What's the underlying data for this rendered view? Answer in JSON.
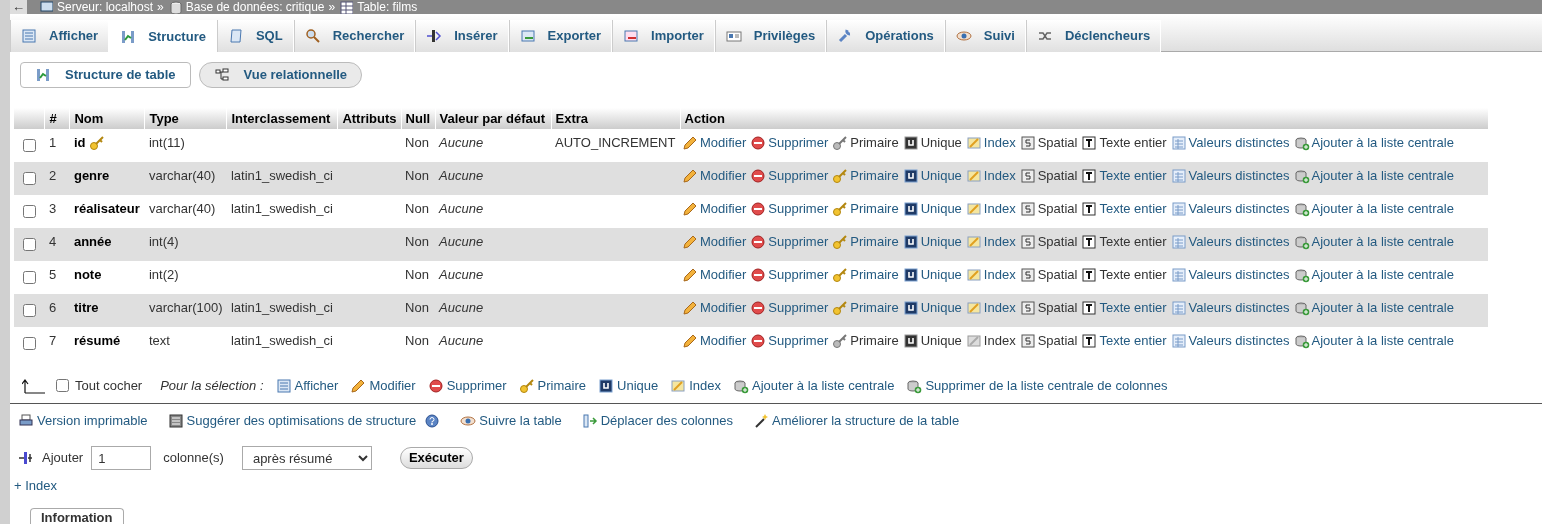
{
  "breadcrumb": {
    "back": "←",
    "items": [
      {
        "label": "Serveur: localhost",
        "separator": "»"
      },
      {
        "label": "Base de données: critique",
        "separator": "»"
      },
      {
        "label": "Table: films"
      }
    ]
  },
  "tabs": [
    {
      "label": "Afficher",
      "selected": false
    },
    {
      "label": "Structure",
      "selected": true
    },
    {
      "label": "SQL",
      "selected": false
    },
    {
      "label": "Rechercher",
      "selected": false
    },
    {
      "label": "Insérer",
      "selected": false
    },
    {
      "label": "Exporter",
      "selected": false
    },
    {
      "label": "Importer",
      "selected": false
    },
    {
      "label": "Privilèges",
      "selected": false
    },
    {
      "label": "Opérations",
      "selected": false
    },
    {
      "label": "Suivi",
      "selected": false
    },
    {
      "label": "Déclencheurs",
      "selected": false
    }
  ],
  "subtabs": [
    {
      "label": "Structure de table",
      "selected": true
    },
    {
      "label": "Vue relationnelle",
      "selected": false
    }
  ],
  "table": {
    "columns": [
      "#",
      "Nom",
      "Type",
      "Interclassement",
      "Attributs",
      "Null",
      "Valeur par défaut",
      "Extra",
      "Action"
    ],
    "rows": [
      {
        "checked": false,
        "num": "1",
        "name": "id",
        "primary_key": true,
        "type": "int(11)",
        "null": "Non",
        "default": "Aucune",
        "extra": "AUTO_INCREMENT",
        "actions": [
          {
            "label": "Modifier",
            "disabled": false
          },
          {
            "label": "Supprimer",
            "disabled": false
          },
          {
            "label": "Primaire",
            "disabled": true
          },
          {
            "label": "Unique",
            "disabled": true
          },
          {
            "label": "Index",
            "disabled": false
          },
          {
            "label": "Spatial",
            "disabled": true
          },
          {
            "label": "Texte entier",
            "disabled": true
          },
          {
            "label": "Valeurs distinctes",
            "disabled": false
          },
          {
            "label": "Ajouter à la liste centrale",
            "disabled": false
          }
        ]
      },
      {
        "checked": false,
        "num": "2",
        "name": "genre",
        "primary_key": false,
        "type": "varchar(40)",
        "collation": "latin1_swedish_ci",
        "null": "Non",
        "default": "Aucune",
        "actions": [
          {
            "label": "Modifier",
            "disabled": false
          },
          {
            "label": "Supprimer",
            "disabled": false
          },
          {
            "label": "Primaire",
            "disabled": false
          },
          {
            "label": "Unique",
            "disabled": false
          },
          {
            "label": "Index",
            "disabled": false
          },
          {
            "label": "Spatial",
            "disabled": true
          },
          {
            "label": "Texte entier",
            "disabled": false
          },
          {
            "label": "Valeurs distinctes",
            "disabled": false
          },
          {
            "label": "Ajouter à la liste centrale",
            "disabled": false
          }
        ]
      },
      {
        "checked": false,
        "num": "3",
        "name": "réalisateur",
        "primary_key": false,
        "type": "varchar(40)",
        "collation": "latin1_swedish_ci",
        "null": "Non",
        "default": "Aucune",
        "actions": [
          {
            "label": "Modifier",
            "disabled": false
          },
          {
            "label": "Supprimer",
            "disabled": false
          },
          {
            "label": "Primaire",
            "disabled": false
          },
          {
            "label": "Unique",
            "disabled": false
          },
          {
            "label": "Index",
            "disabled": false
          },
          {
            "label": "Spatial",
            "disabled": true
          },
          {
            "label": "Texte entier",
            "disabled": false
          },
          {
            "label": "Valeurs distinctes",
            "disabled": false
          },
          {
            "label": "Ajouter à la liste centrale",
            "disabled": false
          }
        ]
      },
      {
        "checked": false,
        "num": "4",
        "name": "année",
        "primary_key": false,
        "type": "int(4)",
        "null": "Non",
        "default": "Aucune",
        "actions": [
          {
            "label": "Modifier",
            "disabled": false
          },
          {
            "label": "Supprimer",
            "disabled": false
          },
          {
            "label": "Primaire",
            "disabled": false
          },
          {
            "label": "Unique",
            "disabled": false
          },
          {
            "label": "Index",
            "disabled": false
          },
          {
            "label": "Spatial",
            "disabled": true
          },
          {
            "label": "Texte entier",
            "disabled": true
          },
          {
            "label": "Valeurs distinctes",
            "disabled": false
          },
          {
            "label": "Ajouter à la liste centrale",
            "disabled": false
          }
        ]
      },
      {
        "checked": false,
        "num": "5",
        "name": "note",
        "primary_key": false,
        "type": "int(2)",
        "null": "Non",
        "default": "Aucune",
        "actions": [
          {
            "label": "Modifier",
            "disabled": false
          },
          {
            "label": "Supprimer",
            "disabled": false
          },
          {
            "label": "Primaire",
            "disabled": false
          },
          {
            "label": "Unique",
            "disabled": false
          },
          {
            "label": "Index",
            "disabled": false
          },
          {
            "label": "Spatial",
            "disabled": true
          },
          {
            "label": "Texte entier",
            "disabled": true
          },
          {
            "label": "Valeurs distinctes",
            "disabled": false
          },
          {
            "label": "Ajouter à la liste centrale",
            "disabled": false
          }
        ]
      },
      {
        "checked": false,
        "num": "6",
        "name": "titre",
        "primary_key": false,
        "type": "varchar(100)",
        "collation": "latin1_swedish_ci",
        "null": "Non",
        "default": "Aucune",
        "actions": [
          {
            "label": "Modifier",
            "disabled": false
          },
          {
            "label": "Supprimer",
            "disabled": false
          },
          {
            "label": "Primaire",
            "disabled": false
          },
          {
            "label": "Unique",
            "disabled": false
          },
          {
            "label": "Index",
            "disabled": false
          },
          {
            "label": "Spatial",
            "disabled": true
          },
          {
            "label": "Texte entier",
            "disabled": false
          },
          {
            "label": "Valeurs distinctes",
            "disabled": false
          },
          {
            "label": "Ajouter à la liste centrale",
            "disabled": false
          }
        ]
      },
      {
        "checked": false,
        "num": "7",
        "name": "résumé",
        "primary_key": false,
        "type": "text",
        "collation": "latin1_swedish_ci",
        "null": "Non",
        "default": "Aucune",
        "actions": [
          {
            "label": "Modifier",
            "disabled": false
          },
          {
            "label": "Supprimer",
            "disabled": false
          },
          {
            "label": "Primaire",
            "disabled": true
          },
          {
            "label": "Unique",
            "disabled": true
          },
          {
            "label": "Index",
            "disabled": true
          },
          {
            "label": "Spatial",
            "disabled": true
          },
          {
            "label": "Texte entier",
            "disabled": false
          },
          {
            "label": "Valeurs distinctes",
            "disabled": false
          },
          {
            "label": "Ajouter à la liste centrale",
            "disabled": false
          }
        ]
      }
    ]
  },
  "selection": {
    "check_all": {
      "label": "Tout cocher",
      "checked": false
    },
    "label": "Pour la sélection :",
    "actions": [
      {
        "label": "Afficher",
        "kind": "list"
      },
      {
        "label": "Modifier",
        "kind": "pencil"
      },
      {
        "label": "Supprimer",
        "kind": "delete"
      },
      {
        "label": "Primaire",
        "kind": "key"
      },
      {
        "label": "Unique",
        "kind": "unique"
      },
      {
        "label": "Index",
        "kind": "index"
      },
      {
        "label": "Ajouter à la liste centrale",
        "kind": "central"
      },
      {
        "label": "Supprimer de la liste centrale de colonnes",
        "kind": "central"
      }
    ]
  },
  "links": [
    {
      "label": "Version imprimable",
      "kind": "print"
    },
    {
      "label": "Suggérer des optimisations de structure",
      "kind": "suggest",
      "help": true
    },
    {
      "label": "Suivre la table",
      "kind": "eye"
    },
    {
      "label": "Déplacer des colonnes",
      "kind": "move"
    },
    {
      "label": "Améliorer la structure de la table",
      "kind": "wand"
    }
  ],
  "add_column": {
    "label": "Ajouter",
    "value": "1",
    "unit": "colonne(s)",
    "position": "après résumé",
    "button": "Exécuter"
  },
  "index_link": "+ Index",
  "info_tab": "Information"
}
